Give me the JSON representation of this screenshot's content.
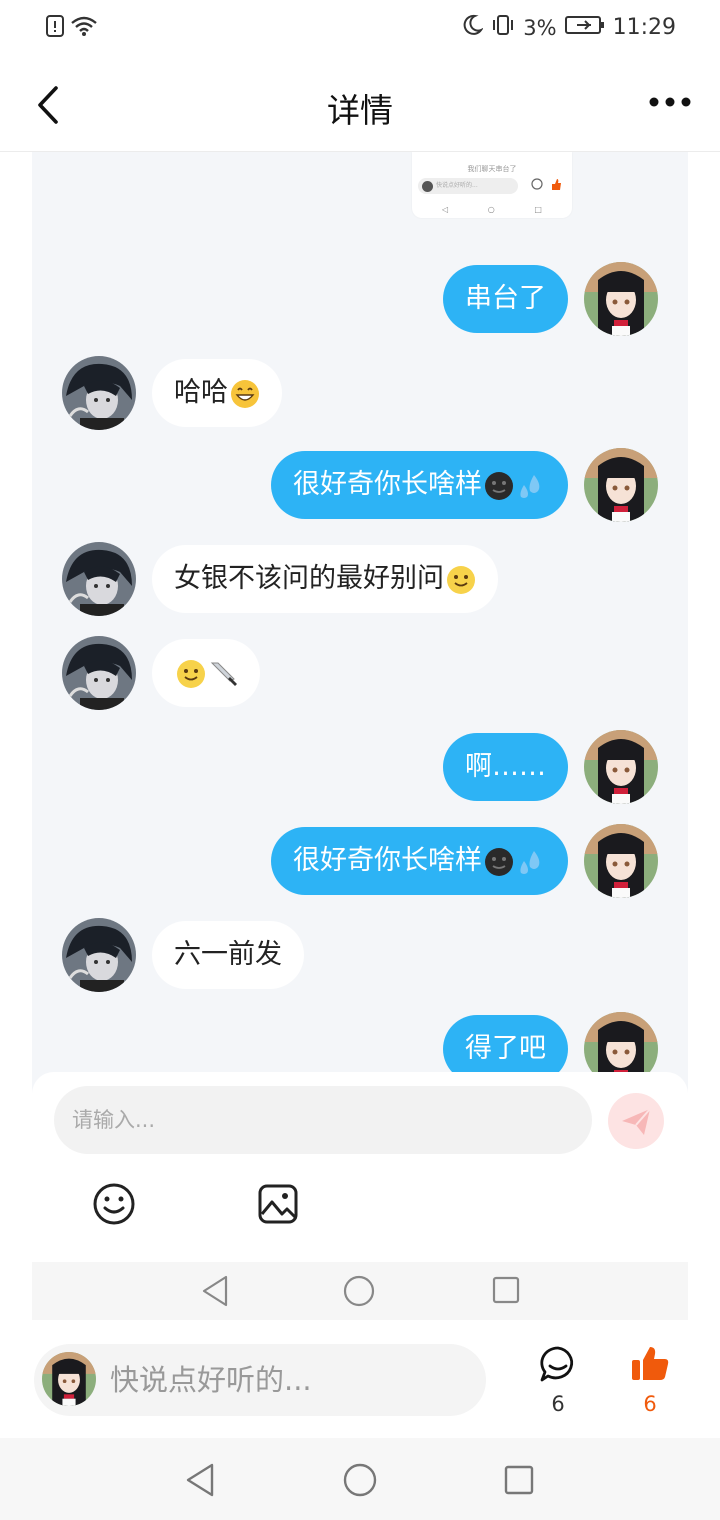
{
  "status_bar": {
    "battery": "3%",
    "time": "11:29",
    "icons": [
      "sim-alert-icon",
      "wifi-icon",
      "moon-icon",
      "vibrate-icon",
      "battery-charging-icon"
    ]
  },
  "header": {
    "title": "详情",
    "icons": [
      "back-arrow-icon",
      "more-dots-icon"
    ]
  },
  "screenshot": {
    "thumbnail": {
      "caption": "我们聊天串台了",
      "input_placeholder": "快说点好听的..."
    },
    "messages": [
      {
        "side": "me",
        "text": "串台了",
        "emoji": []
      },
      {
        "side": "other",
        "text": "哈哈",
        "emoji": [
          "grin"
        ]
      },
      {
        "side": "me",
        "text": "很好奇你长啥样",
        "emoji": [
          "dark-face",
          "sweat-drops"
        ]
      },
      {
        "side": "other",
        "text": "女银不该问的最好别问",
        "emoji": [
          "smile"
        ]
      },
      {
        "side": "other",
        "text": "",
        "emoji": [
          "smile",
          "knife"
        ]
      },
      {
        "side": "me",
        "text": "啊……",
        "emoji": []
      },
      {
        "side": "me",
        "text": "很好奇你长啥样",
        "emoji": [
          "dark-face",
          "sweat-drops"
        ]
      },
      {
        "side": "other",
        "text": "六一前发",
        "emoji": []
      },
      {
        "side": "me",
        "text": "得了吧",
        "emoji": []
      }
    ],
    "input_placeholder": "请输入..."
  },
  "comment_bar": {
    "placeholder": "快说点好听的...",
    "comment_count": "6",
    "like_count": "6"
  },
  "colors": {
    "my_bubble": "#2db3f5",
    "other_bubble": "#ffffff",
    "chat_bg": "#f4f6f9",
    "like_accent": "#f05a0c"
  }
}
